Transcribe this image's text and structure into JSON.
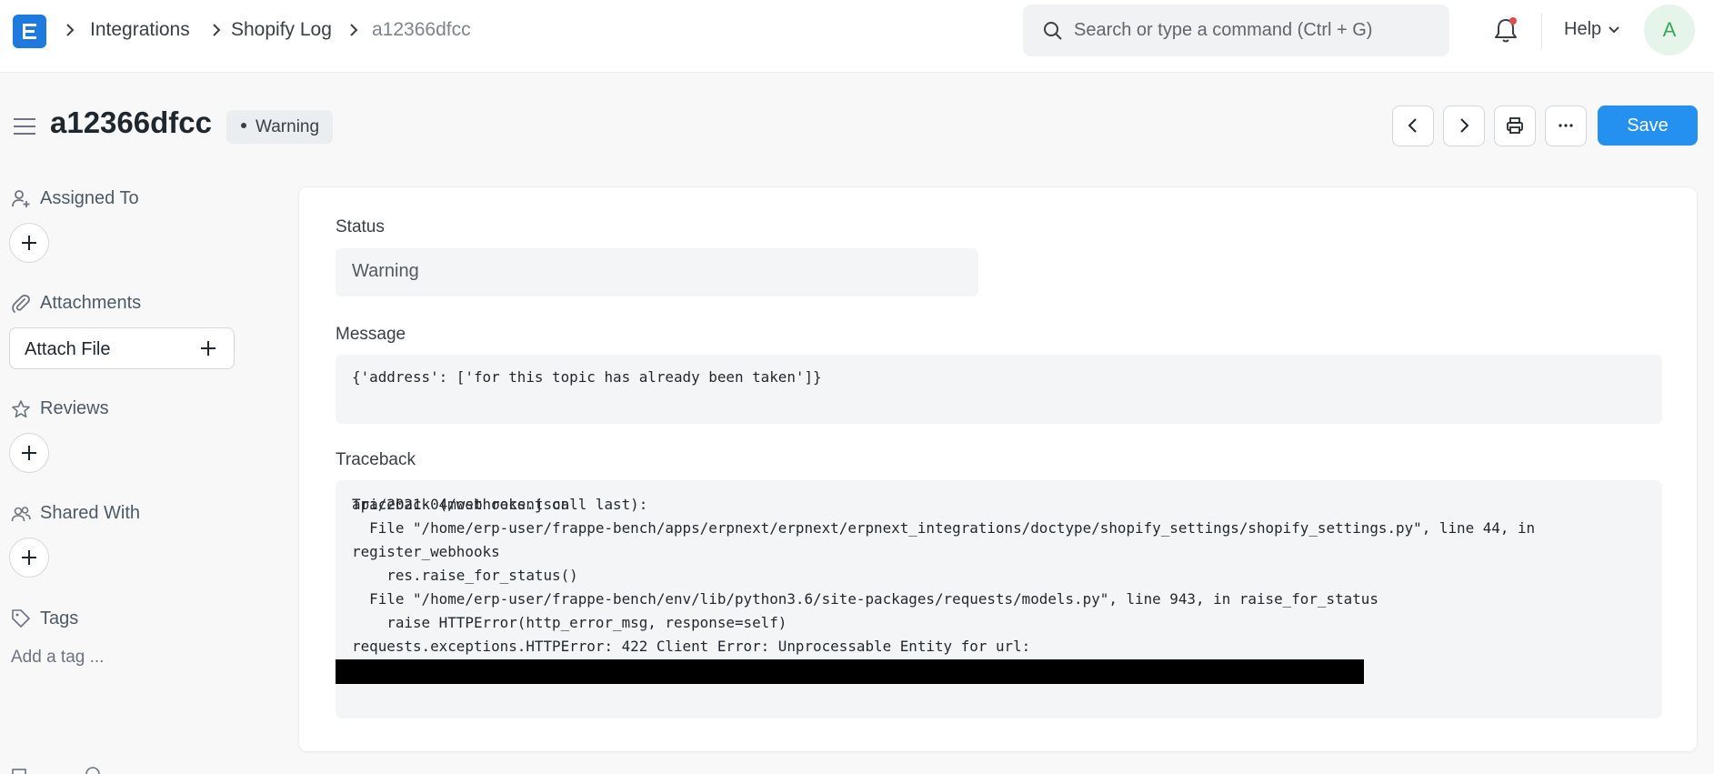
{
  "navbar": {
    "breadcrumbs": [
      {
        "label": "Integrations"
      },
      {
        "label": "Shopify Log"
      },
      {
        "label": "a12366dfcc"
      }
    ],
    "search_placeholder": "Search or type a command (Ctrl + G)",
    "help_label": "Help",
    "avatar_initial": "A"
  },
  "page": {
    "title": "a12366dfcc",
    "status_indicator": "Warning",
    "save_label": "Save"
  },
  "sidebar": {
    "assigned_to": "Assigned To",
    "attachments": "Attachments",
    "attach_file": "Attach File",
    "reviews": "Reviews",
    "shared_with": "Shared With",
    "tags": "Tags",
    "add_tag": "Add a tag ..."
  },
  "form": {
    "status_label": "Status",
    "status_value": "Warning",
    "message_label": "Message",
    "message_value": "{'address': ['for this topic has already been taken']}",
    "traceback_label": "Traceback",
    "traceback_text": "Traceback (most recent call last):\n  File \"/home/erp-user/frappe-bench/apps/erpnext/erpnext/erpnext_integrations/doctype/shopify_settings/shopify_settings.py\", line 44, in\nregister_webhooks\n    res.raise_for_status()\n  File \"/home/erp-user/frappe-bench/env/lib/python3.6/site-packages/requests/models.py\", line 943, in raise_for_status\n    raise HTTPError(http_error_msg, response=self)\nrequests.exceptions.HTTPError: 422 Client Error: Unprocessable Entity for url:",
    "traceback_tail": "api/2021-04/webhooks.json"
  },
  "colors": {
    "primary": "#2490ef",
    "logo": "#1f7ae0",
    "notification_dot": "#e24c4c",
    "avatar_bg": "#e5f5ea",
    "avatar_fg": "#3aa65c"
  }
}
